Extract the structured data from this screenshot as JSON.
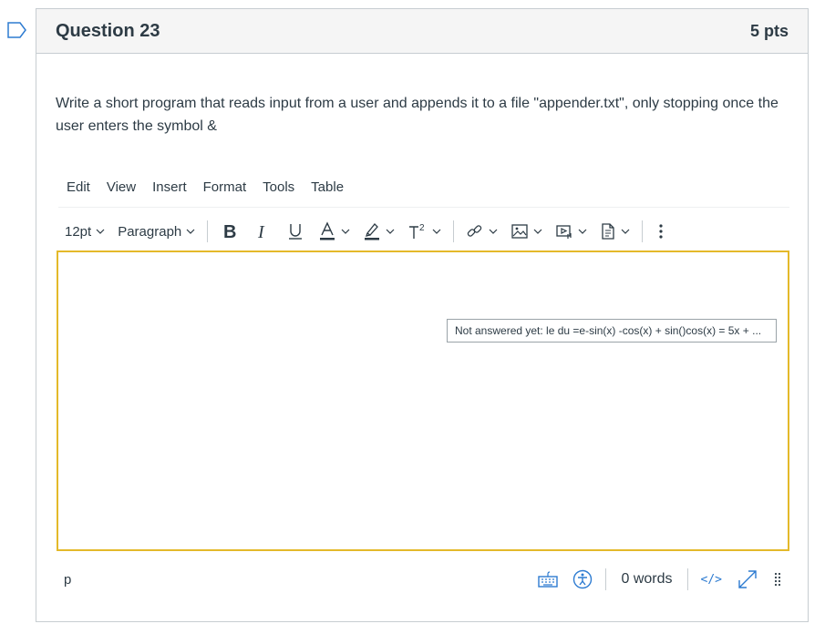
{
  "question": {
    "title": "Question 23",
    "points": "5 pts",
    "text": "Write a short program that reads input from a user and appends it to a file \"appender.txt\", only stopping once the user enters the symbol &"
  },
  "editor": {
    "menu": [
      "Edit",
      "View",
      "Insert",
      "Format",
      "Tools",
      "Table"
    ],
    "font_size": "12pt",
    "block_format": "Paragraph",
    "tooltip": "Not answered yet: le du =e-sin(x) -cos(x) + sin()cos(x) = 5x + ...",
    "status_path": "p",
    "word_count": "0 words",
    "html_toggle": "</>",
    "icons": [
      "bold-icon",
      "italic-icon",
      "underline-icon",
      "text-color-icon",
      "highlight-icon",
      "superscript-icon",
      "link-icon",
      "image-icon",
      "media-icon",
      "document-icon",
      "more-icon",
      "keyboard-icon",
      "accessibility-icon",
      "expand-icon",
      "resize-grip-icon"
    ],
    "colors": {
      "accent": "#2d7bd1",
      "focus_border": "#e4b92a",
      "text": "#2d3b45",
      "border": "#c7cdd1"
    }
  }
}
